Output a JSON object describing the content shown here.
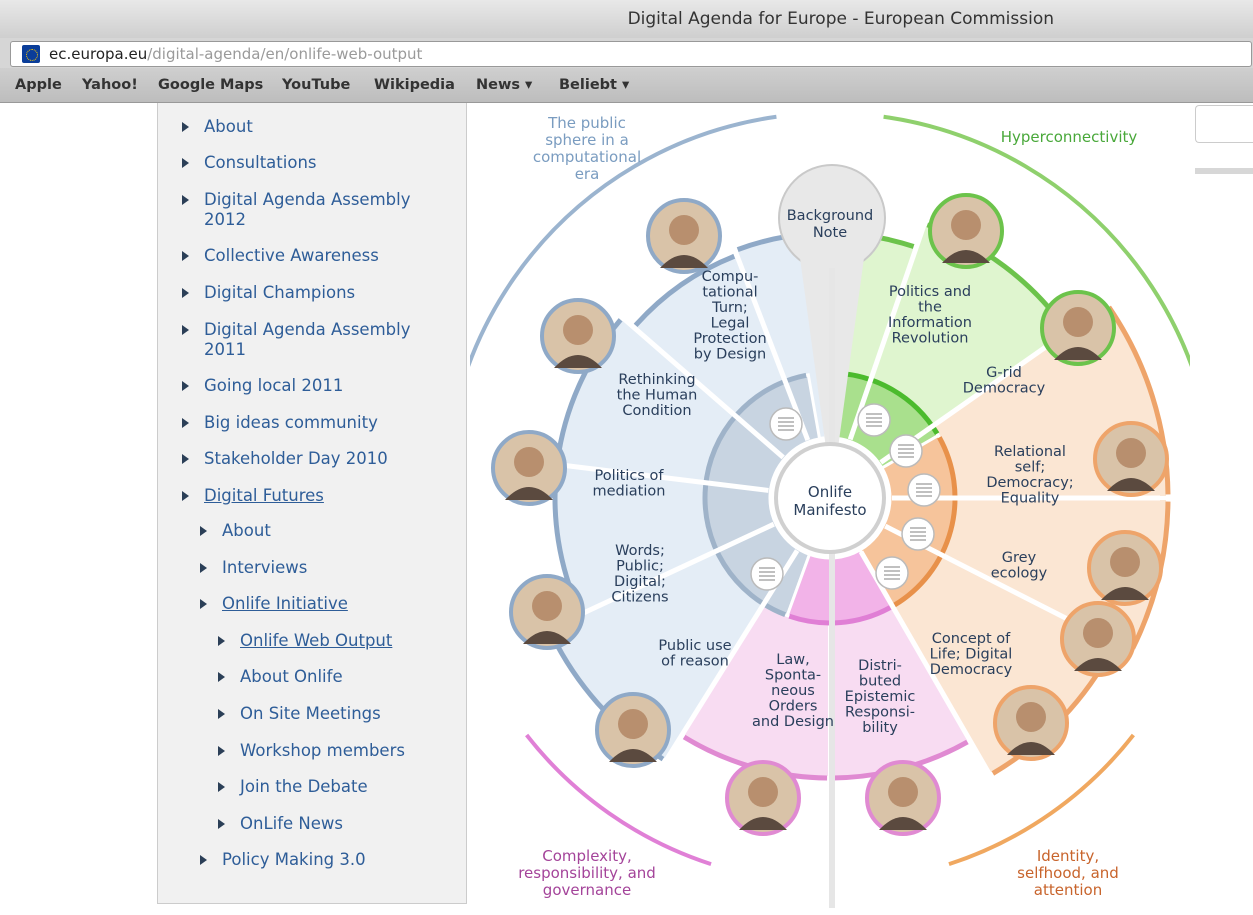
{
  "window": {
    "title": "Digital Agenda for Europe - European Commission"
  },
  "address_bar": {
    "domain": "ec.europa.eu",
    "path": "/digital-agenda/en/onlife-web-output"
  },
  "bookmarks": [
    "Apple",
    "Yahoo!",
    "Google Maps",
    "YouTube",
    "Wikipedia",
    "News ▾",
    "Beliebt ▾"
  ],
  "sidebar": {
    "items": [
      "About",
      "Consultations",
      "Digital Agenda Assembly 2012",
      "Collective Awareness",
      "Digital Champions",
      "Digital Agenda Assembly 2011",
      "Going local 2011",
      "Big ideas community",
      "Stakeholder Day 2010",
      "Digital Futures"
    ],
    "sub_items": [
      "About",
      "Interviews",
      "Onlife Initiative"
    ],
    "subsub_items": [
      "Onlife Web Output",
      "About Onlife",
      "On Site Meetings",
      "Workshop members",
      "Join the Debate",
      "OnLife News"
    ],
    "last_item": "Policy Making 3.0"
  },
  "wheel": {
    "center": [
      "Onlife",
      "Manifesto"
    ],
    "background_note": [
      "Background",
      "Note"
    ],
    "quadrants": [
      {
        "label": [
          "The public",
          "sphere in a",
          "computational",
          "era"
        ],
        "color": "#7a9cc0"
      },
      {
        "label": [
          "Hyperconnectivity"
        ],
        "color": "#49a83a"
      },
      {
        "label": [
          "Complexity,",
          "responsibility, and",
          "governance"
        ],
        "color": "#a4449a"
      },
      {
        "label": [
          "Identity,",
          "selfhood, and",
          "attention"
        ],
        "color": "#c8642c"
      }
    ],
    "segments": [
      [
        "Compu-",
        "tational",
        "Turn;",
        "Legal",
        "Protection",
        "by Design"
      ],
      [
        "Rethinking",
        "the Human",
        "Condition"
      ],
      [
        "Politics of",
        "mediation"
      ],
      [
        "Words;",
        "Public;",
        "Digital;",
        "Citizens"
      ],
      [
        "Public use",
        "of reason"
      ],
      [
        "Law,",
        "Sponta-",
        "neous",
        "Orders",
        "and Design"
      ],
      [
        "Distri-",
        "buted",
        "Epistemic",
        "Responsi-",
        "bility"
      ],
      [
        "Politics and",
        "the",
        "Information",
        "Revolution"
      ],
      [
        "G-rid",
        "Democracy"
      ],
      [
        "Relational",
        "self;",
        "Democracy;",
        "Equality"
      ],
      [
        "Grey",
        "ecology"
      ],
      [
        "Concept of",
        "Life; Digital",
        "Democracy"
      ]
    ],
    "colors": {
      "blue": "#e4edf6",
      "blue_border": "#8fa9c7",
      "green": "#dff5cf",
      "green_border": "#6cc34b",
      "orange": "#fbe6d3",
      "orange_border": "#eea46a",
      "pink": "#f8dcf2",
      "pink_border": "#e08ad2",
      "text": "#2a3f5c"
    }
  }
}
